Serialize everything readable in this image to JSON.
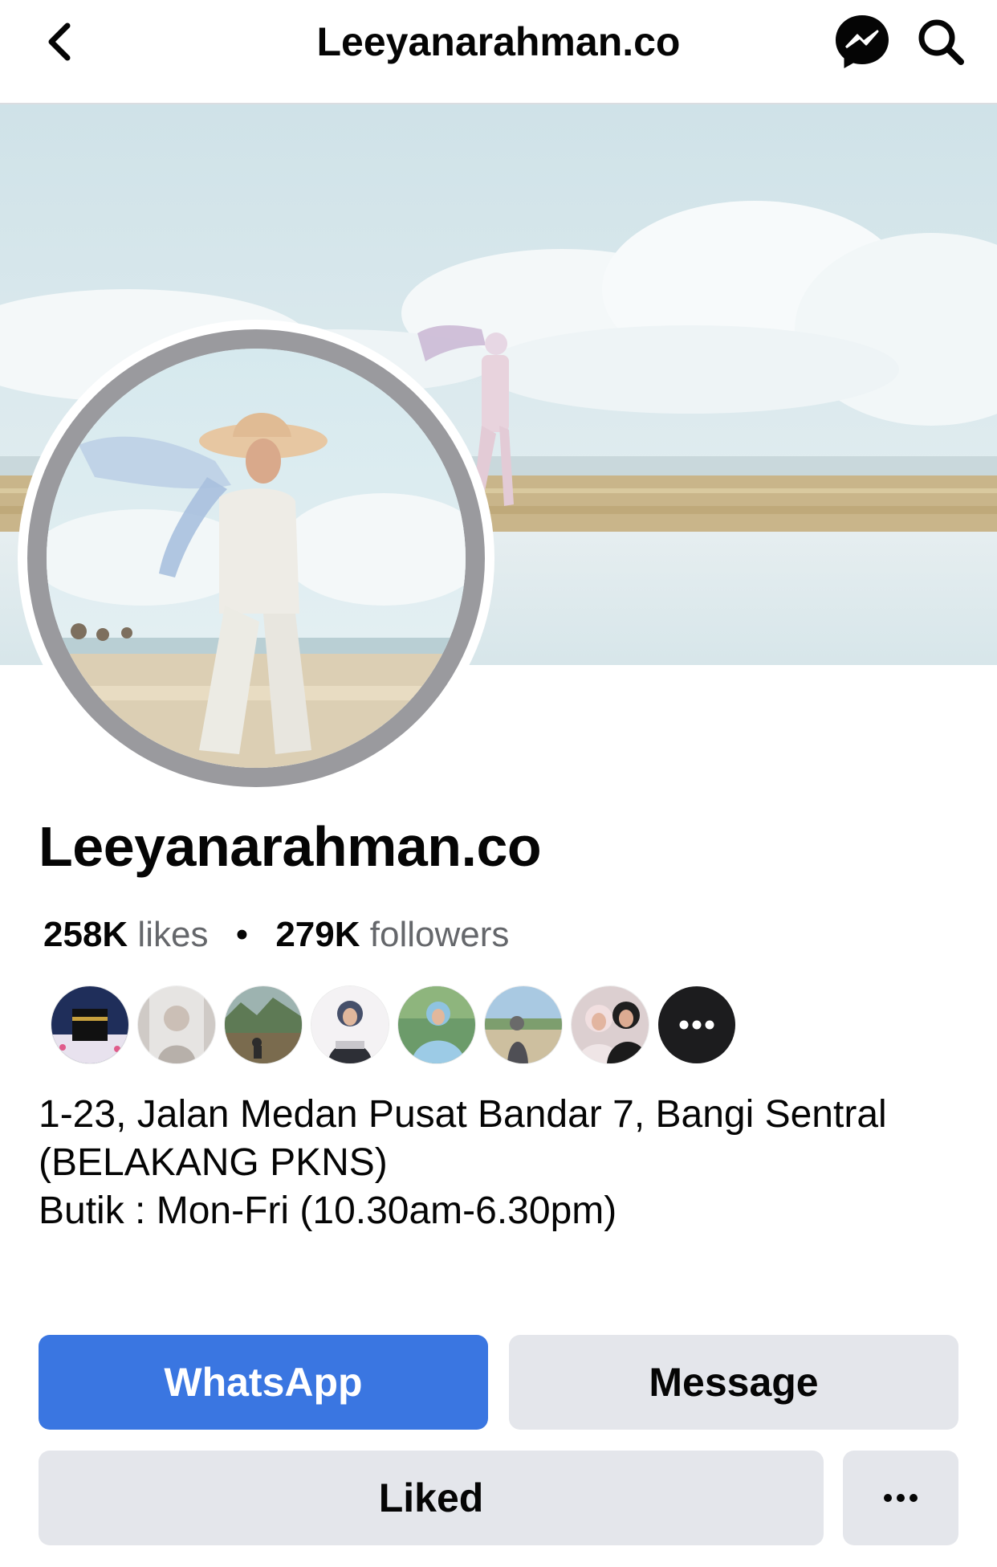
{
  "header": {
    "title": "Leeyanarahman.co",
    "back_icon": "chevron-left-icon",
    "messenger_icon": "messenger-icon",
    "search_icon": "search-icon"
  },
  "profile": {
    "name": "Leeyanarahman.co",
    "likes_count": "258K",
    "likes_label": "likes",
    "separator": "•",
    "followers_count": "279K",
    "followers_label": "followers"
  },
  "friends_who_like": {
    "visible_avatars": 8,
    "more_icon": "more-dots-icon"
  },
  "about": {
    "line1": "1-23, Jalan Medan Pusat Bandar 7, Bangi Sentral",
    "line2": "(BELAKANG PKNS)",
    "line3": "Butik : Mon-Fri (10.30am-6.30pm)"
  },
  "actions": {
    "whatsapp_label": "WhatsApp",
    "message_label": "Message",
    "liked_label": "Liked",
    "more_label": "•••"
  },
  "colors": {
    "primary_button": "#3a76e1",
    "secondary_button": "#e4e6eb",
    "text_primary": "#050505",
    "text_secondary": "#65676b"
  }
}
